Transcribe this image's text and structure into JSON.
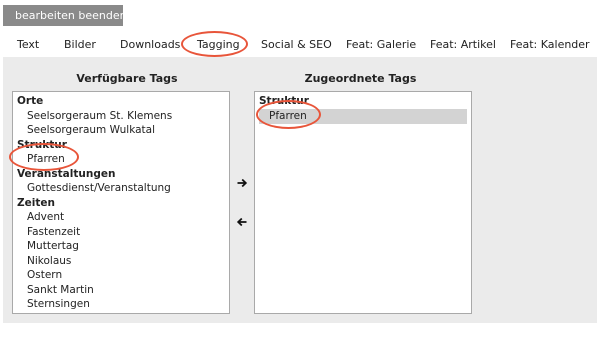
{
  "toolbar": {
    "exit_edit_label": "bearbeiten beenden",
    "exit_icon": "exit-icon"
  },
  "tabs": [
    {
      "label": "Text"
    },
    {
      "label": "Bilder"
    },
    {
      "label": "Downloads"
    },
    {
      "label": "Tagging",
      "active": true
    },
    {
      "label": "Social & SEO"
    },
    {
      "label": "Feat: Galerie"
    },
    {
      "label": "Feat: Artikel"
    },
    {
      "label": "Feat: Kalender"
    }
  ],
  "available": {
    "title": "Verfügbare Tags",
    "items": [
      {
        "label": "Orte",
        "group": true
      },
      {
        "label": "Seelsorgeraum St. Klemens"
      },
      {
        "label": "Seelsorgeraum Wulkatal"
      },
      {
        "label": "Struktur",
        "group": true
      },
      {
        "label": "Pfarren"
      },
      {
        "label": "Veranstaltungen",
        "group": true
      },
      {
        "label": "Gottesdienst/Veranstaltung"
      },
      {
        "label": "Zeiten",
        "group": true
      },
      {
        "label": "Advent"
      },
      {
        "label": "Fastenzeit"
      },
      {
        "label": "Muttertag"
      },
      {
        "label": "Nikolaus"
      },
      {
        "label": "Ostern"
      },
      {
        "label": "Sankt Martin"
      },
      {
        "label": "Sternsingen"
      }
    ]
  },
  "assigned": {
    "title": "Zugeordnete Tags",
    "items": [
      {
        "label": "Struktur",
        "group": true
      },
      {
        "label": "Pfarren",
        "selected": true
      }
    ]
  },
  "move_right_icon": "arrow-right-icon",
  "move_left_icon": "arrow-left-icon",
  "highlight_color": "#e8553a"
}
